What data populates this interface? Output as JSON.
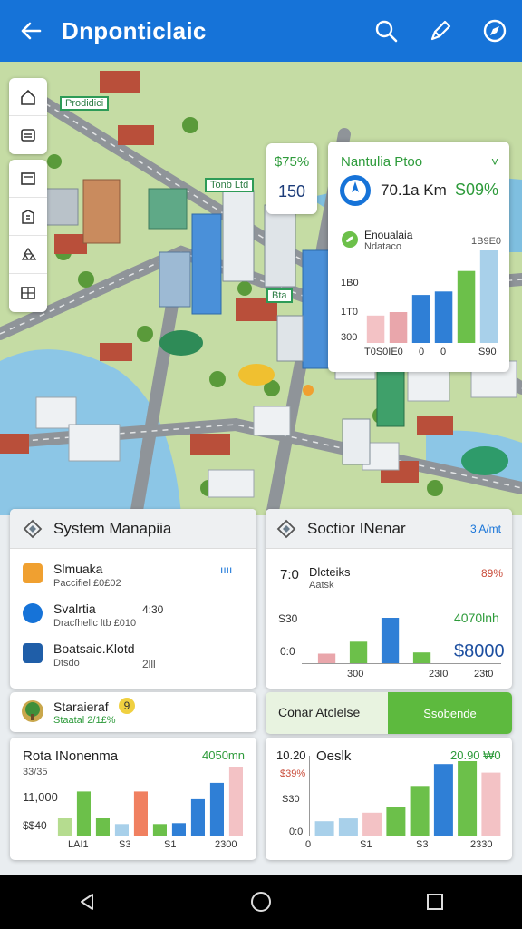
{
  "app_bar": {
    "title": "Dnponticlaic",
    "icons": [
      "back-arrow-icon",
      "search-icon",
      "pen-icon",
      "compass-icon"
    ]
  },
  "map": {
    "tool_icons": [
      "home-icon",
      "layers-icon",
      "image-icon",
      "building-icon",
      "recycle-icon",
      "grid-icon"
    ],
    "labels": [
      "Prodidici",
      "Tonb Ltd",
      "Bta"
    ],
    "stat_card": {
      "top": "$75%",
      "bottom": "150"
    },
    "info_card": {
      "title": "Nantulia Ptoo",
      "chevron": "˅",
      "metric_a": "70.1a Km",
      "metric_b": "S09%",
      "sub_title": "Enoualaia",
      "sub_caption": "Ndataco",
      "right_top": "1B9E0",
      "chart_data": {
        "type": "bar",
        "y_ticks": [
          "1B0",
          "1T0",
          "300"
        ],
        "x_labels": [
          "T0S0IE0",
          "0",
          "0",
          "S90"
        ],
        "values": [
          40,
          45,
          70,
          75,
          105,
          135
        ],
        "colors": [
          "#f3c2c5",
          "#e9a6ab",
          "#2f7fd6",
          "#2f7fd6",
          "#6cc04a",
          "#a8d0ea"
        ]
      }
    }
  },
  "panel_system": {
    "title": "System Manapiia",
    "items": [
      {
        "name": "Slmuaka",
        "sub": "Paccifiel £0£02",
        "value": "ıııı",
        "value_color": "#1673d8",
        "icon": "briefcase-icon",
        "icon_color": "#f0a030"
      },
      {
        "name": "Svalrtia",
        "sub": "Dracfhellc ltb £010",
        "value": "4:30",
        "value_color": "#333333",
        "icon": "globe-icon",
        "icon_color": "#1673d8"
      },
      {
        "name": "Boatsaic.Klotd",
        "sub": "Dtsdo",
        "value": "2lll",
        "value_color": "#555555",
        "icon": "cube-icon",
        "icon_color": "#1f5ea8"
      }
    ]
  },
  "panel_station": {
    "title": "Soctior INenar",
    "badge": "3 A/mt",
    "left_value": "7:0",
    "name": "Dlcteiks",
    "sub": "Aatsk",
    "percent": "89%",
    "side_labels": [
      "S30",
      "0:0"
    ],
    "highlight": "4070lnh",
    "amount": "$8000",
    "x_labels": [
      "300",
      "23I0",
      "23t0"
    ],
    "chart_data": {
      "type": "bar",
      "values": [
        8,
        18,
        38,
        9
      ],
      "colors": [
        "#e9a6ab",
        "#6cc04a",
        "#2f7fd6",
        "#6cc04a"
      ]
    }
  },
  "panel_status": {
    "title": "Staraieraf",
    "badge": "9",
    "sub": "Staatal 2/1£%"
  },
  "panel_actions": {
    "title": "Conar Atclelse",
    "button": "Ssobende"
  },
  "panel_revenue": {
    "title": "Rota INonenma",
    "value": "4050mn",
    "sub": "33/35",
    "y_labels": [
      "11,000",
      "$$40"
    ],
    "x_labels": [
      "LAI1",
      "S3",
      "S1",
      "2300"
    ],
    "chart_data": {
      "type": "bar",
      "values": [
        18,
        46,
        18,
        12,
        46,
        12,
        13,
        38,
        55,
        72
      ],
      "colors": [
        "#b5dc8f",
        "#6cc04a",
        "#6cc04a",
        "#a8d0ea",
        "#f08060",
        "#6cc04a",
        "#2f7fd6",
        "#2f7fd6",
        "#2f7fd6",
        "#f3c2c5"
      ]
    }
  },
  "panel_desk": {
    "title": "Oeslk",
    "left_value": "10.20",
    "value": "20.90 ₩0",
    "side_labels": [
      "$39%",
      "S30",
      "0:0"
    ],
    "x_labels": [
      "0",
      "S1",
      "S3",
      "2330"
    ],
    "chart_data": {
      "type": "bar",
      "values": [
        15,
        18,
        24,
        30,
        52,
        75,
        78,
        66
      ],
      "colors": [
        "#a8d0ea",
        "#a8d0ea",
        "#f3c2c5",
        "#6cc04a",
        "#6cc04a",
        "#2f7fd6",
        "#6cc04a",
        "#f3c2c5"
      ]
    }
  },
  "nav": {
    "icons": [
      "nav-back-icon",
      "nav-home-icon",
      "nav-recents-icon"
    ]
  }
}
